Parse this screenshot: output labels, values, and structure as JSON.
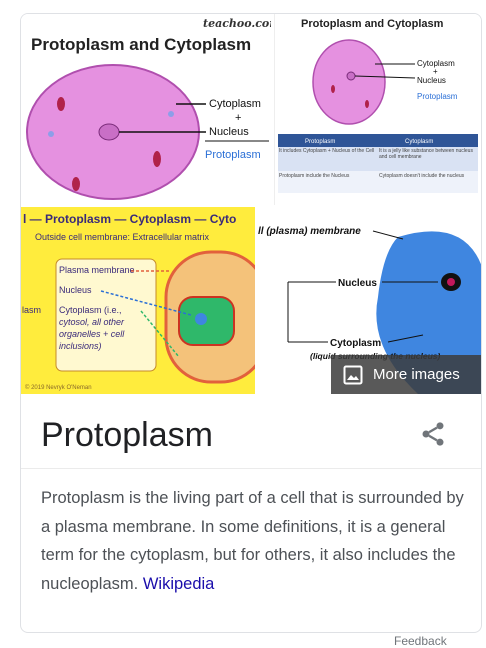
{
  "gallery": {
    "tile1": {
      "watermark": "teachoo.com",
      "heading": "Protoplasm and Cytoplasm",
      "label_cytoplasm": "Cytoplasm",
      "label_plus": "+",
      "label_nucleus": "Nucleus",
      "label_protoplasm": "Protoplasm"
    },
    "tile2": {
      "heading": "Protoplasm and Cytoplasm",
      "label_cytoplasm": "Cytoplasm",
      "label_plus": "+",
      "label_nucleus": "Nucleus",
      "label_protoplasm": "Protoplasm",
      "table_header_left": "Protoplasm",
      "table_header_right": "Cytoplasm",
      "row1_left": "It includes Cytoplasm + Nucleus of the Cell",
      "row1_right": "It is a jelly like substance between nucleus and cell membrane",
      "row2_left": "Protoplasm include the Nucleus",
      "row2_right": "Cytoplasm doesn't include the nucleus"
    },
    "tile3": {
      "heading": "l — Protoplasm — Cytoplasm — Cyto",
      "subheading": "Outside cell membrane: Extracellular matrix",
      "plasma_membrane": "Plasma membrane",
      "nucleus": "Nucleus",
      "cytoplasm_line1": "Cytoplasm (i.e.,",
      "cytoplasm_line2": "cytosol, all other",
      "cytoplasm_line3": "organelles + cell",
      "cytoplasm_line4": "inclusions)",
      "left_cut": "lasm",
      "copyright": "© 2019 Nevryk O'Neman"
    },
    "tile4": {
      "membrane": "ll (plasma) membrane",
      "nucleus": "Nucleus",
      "cytoplasm": "Cytoplasm",
      "cytoplasm_note": "(liquid surrounding the nucleus)"
    },
    "more_images": "More images"
  },
  "panel": {
    "title": "Protoplasm",
    "description": "Protoplasm is the living part of a cell that is surrounded by a plasma membrane. In some definitions, it is a general term for the cytoplasm, but for others, it also includes the nucleoplasm.",
    "source_link": "Wikipedia"
  },
  "footer": {
    "feedback": "Feedback"
  },
  "colors": {
    "cell_pink": "#e591e0",
    "cell_blue": "#3f86e0",
    "link": "#1a0dab"
  }
}
